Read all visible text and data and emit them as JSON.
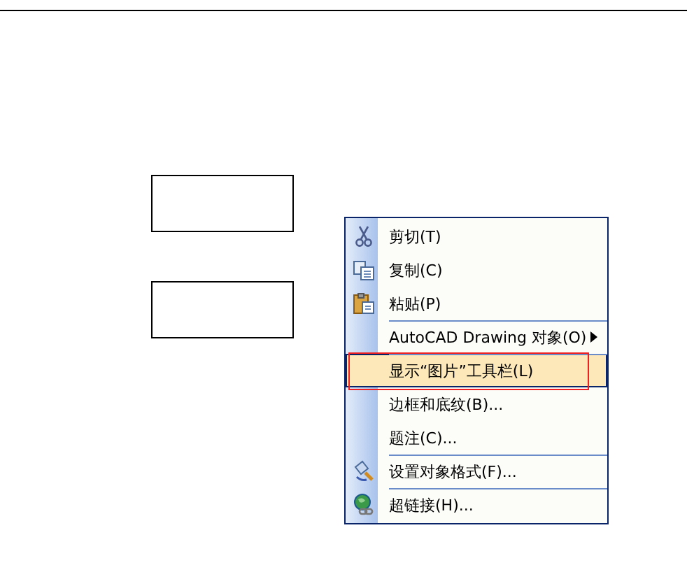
{
  "context_menu": {
    "items": [
      {
        "label": "剪切(T)",
        "submenu": false,
        "separator_before": false,
        "selected": false
      },
      {
        "label": "复制(C)",
        "submenu": false,
        "separator_before": false,
        "selected": false
      },
      {
        "label": "粘贴(P)",
        "submenu": false,
        "separator_before": false,
        "selected": false
      },
      {
        "label": "AutoCAD Drawing 对象(O)",
        "submenu": true,
        "separator_before": true,
        "selected": false
      },
      {
        "label": "显示“图片”工具栏(L)",
        "submenu": false,
        "separator_before": true,
        "selected": true
      },
      {
        "label": "边框和底纹(B)...",
        "submenu": false,
        "separator_before": false,
        "selected": false
      },
      {
        "label": "题注(C)...",
        "submenu": false,
        "separator_before": false,
        "selected": false
      },
      {
        "label": "设置对象格式(F)...",
        "submenu": false,
        "separator_before": true,
        "selected": false
      },
      {
        "label": "超链接(H)...",
        "submenu": false,
        "separator_before": true,
        "selected": false
      }
    ]
  }
}
